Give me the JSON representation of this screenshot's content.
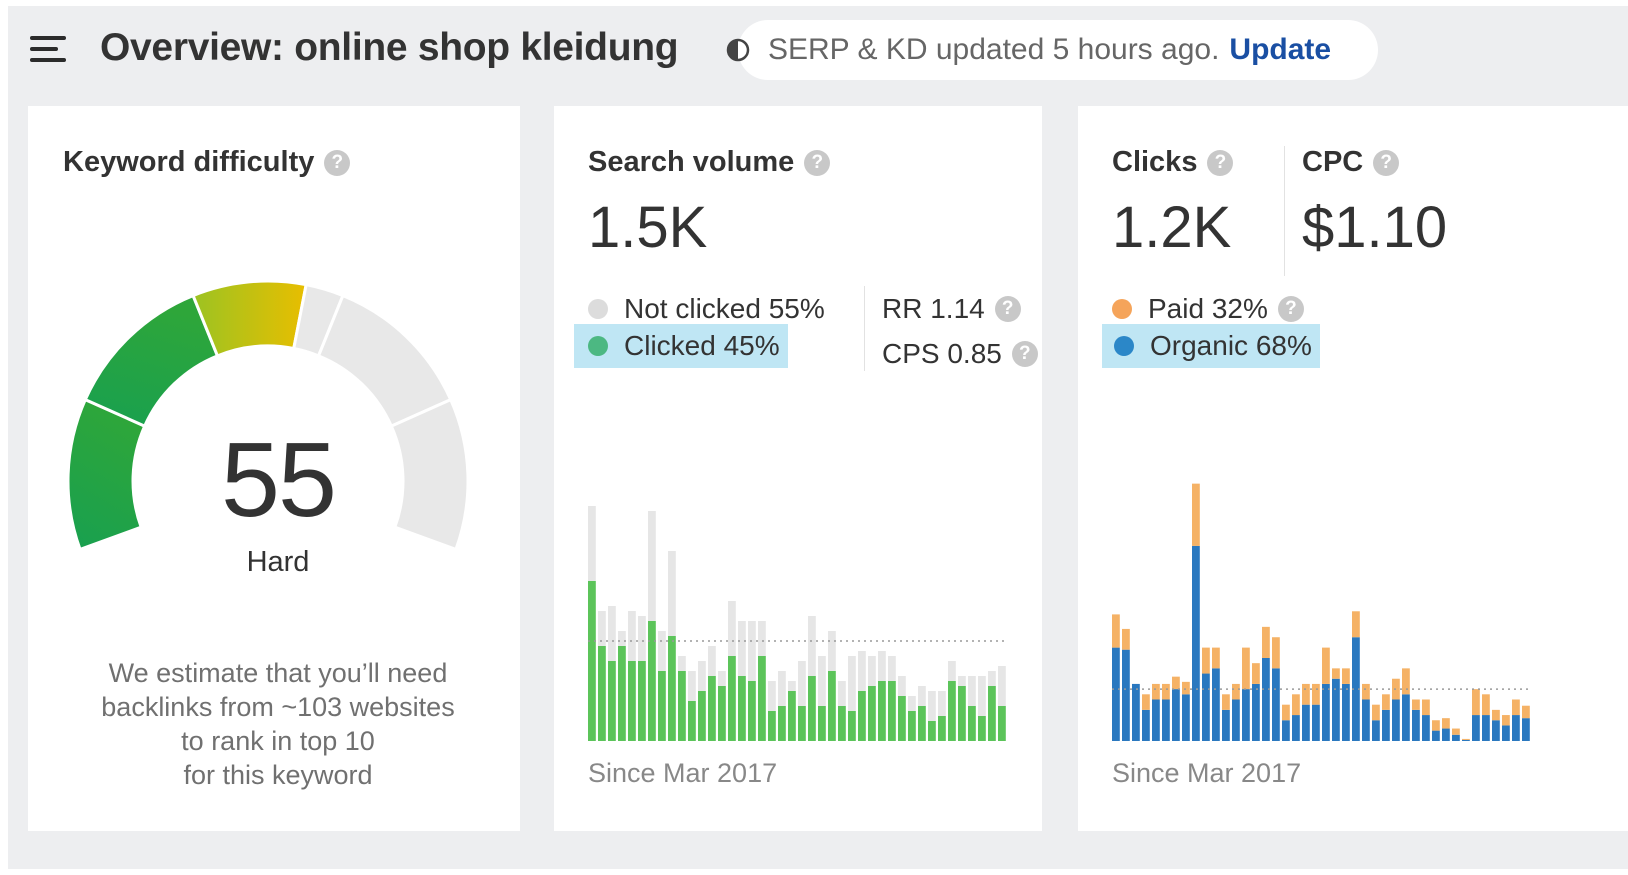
{
  "header": {
    "title": "Overview: online shop kleidung",
    "status_text": "SERP & KD updated 5 hours ago.",
    "update_label": "Update"
  },
  "keyword_difficulty": {
    "title": "Keyword difficulty",
    "value": "55",
    "label": "Hard",
    "description": [
      "We estimate that you’ll need",
      "backlinks from ~103 websites",
      "to rank in top 10",
      "for this keyword"
    ],
    "gauge_fraction": 0.55
  },
  "search_volume": {
    "title": "Search volume",
    "value": "1.5K",
    "legend": [
      {
        "label": "Not clicked 55%",
        "color": "#dcdcdc"
      },
      {
        "label": "Clicked 45%",
        "color": "#4cb882"
      }
    ],
    "rr": "RR 1.14",
    "cps": "CPS 0.85",
    "since": "Since Mar 2017"
  },
  "clicks": {
    "title": "Clicks",
    "value": "1.2K",
    "legend": [
      {
        "label": "Paid 32%",
        "color": "#f5a45a"
      },
      {
        "label": "Organic 68%",
        "color": "#2b87c8"
      }
    ],
    "since": "Since Mar 2017"
  },
  "cpc": {
    "title": "CPC",
    "value": "$1.10"
  },
  "colors": {
    "clicked_bar": "#5cc45a",
    "not_clicked_bar": "#e6e6e6",
    "organic_bar": "#2a78bf",
    "paid_bar": "#f5b266",
    "update_link": "#1a4fa3"
  },
  "chart_data": [
    {
      "type": "bar",
      "title": "Search volume",
      "stacked": true,
      "series": [
        {
          "name": "Clicked",
          "values": [
            160,
            95,
            80,
            95,
            80,
            80,
            120,
            70,
            105,
            70,
            40,
            50,
            65,
            55,
            85,
            65,
            60,
            85,
            30,
            35,
            50,
            35,
            65,
            35,
            70,
            35,
            30,
            50,
            55,
            60,
            60,
            45,
            30,
            35,
            20,
            25,
            60,
            55,
            35,
            25,
            55,
            35
          ]
        },
        {
          "name": "Not clicked",
          "values": [
            75,
            35,
            55,
            15,
            50,
            45,
            110,
            40,
            85,
            15,
            30,
            30,
            30,
            15,
            55,
            55,
            60,
            35,
            30,
            35,
            10,
            45,
            60,
            50,
            40,
            25,
            55,
            40,
            30,
            30,
            25,
            20,
            15,
            20,
            30,
            25,
            20,
            10,
            30,
            40,
            15,
            40
          ]
        }
      ],
      "reference_line": 100
    },
    {
      "type": "bar",
      "title": "Clicks",
      "stacked": true,
      "series": [
        {
          "name": "Organic",
          "values": [
            90,
            88,
            55,
            30,
            40,
            40,
            50,
            45,
            188,
            65,
            70,
            30,
            40,
            50,
            55,
            80,
            70,
            20,
            25,
            35,
            35,
            55,
            60,
            55,
            100,
            40,
            20,
            30,
            40,
            45,
            30,
            25,
            10,
            12,
            6,
            1,
            25,
            25,
            20,
            15,
            25,
            22
          ]
        },
        {
          "name": "Paid",
          "values": [
            32,
            20,
            0,
            15,
            15,
            15,
            12,
            12,
            60,
            25,
            20,
            15,
            15,
            40,
            20,
            30,
            30,
            15,
            20,
            20,
            20,
            35,
            10,
            15,
            25,
            15,
            15,
            15,
            20,
            25,
            10,
            15,
            10,
            10,
            6,
            1,
            25,
            20,
            10,
            10,
            15,
            12
          ]
        }
      ],
      "reference_line": 50
    }
  ]
}
